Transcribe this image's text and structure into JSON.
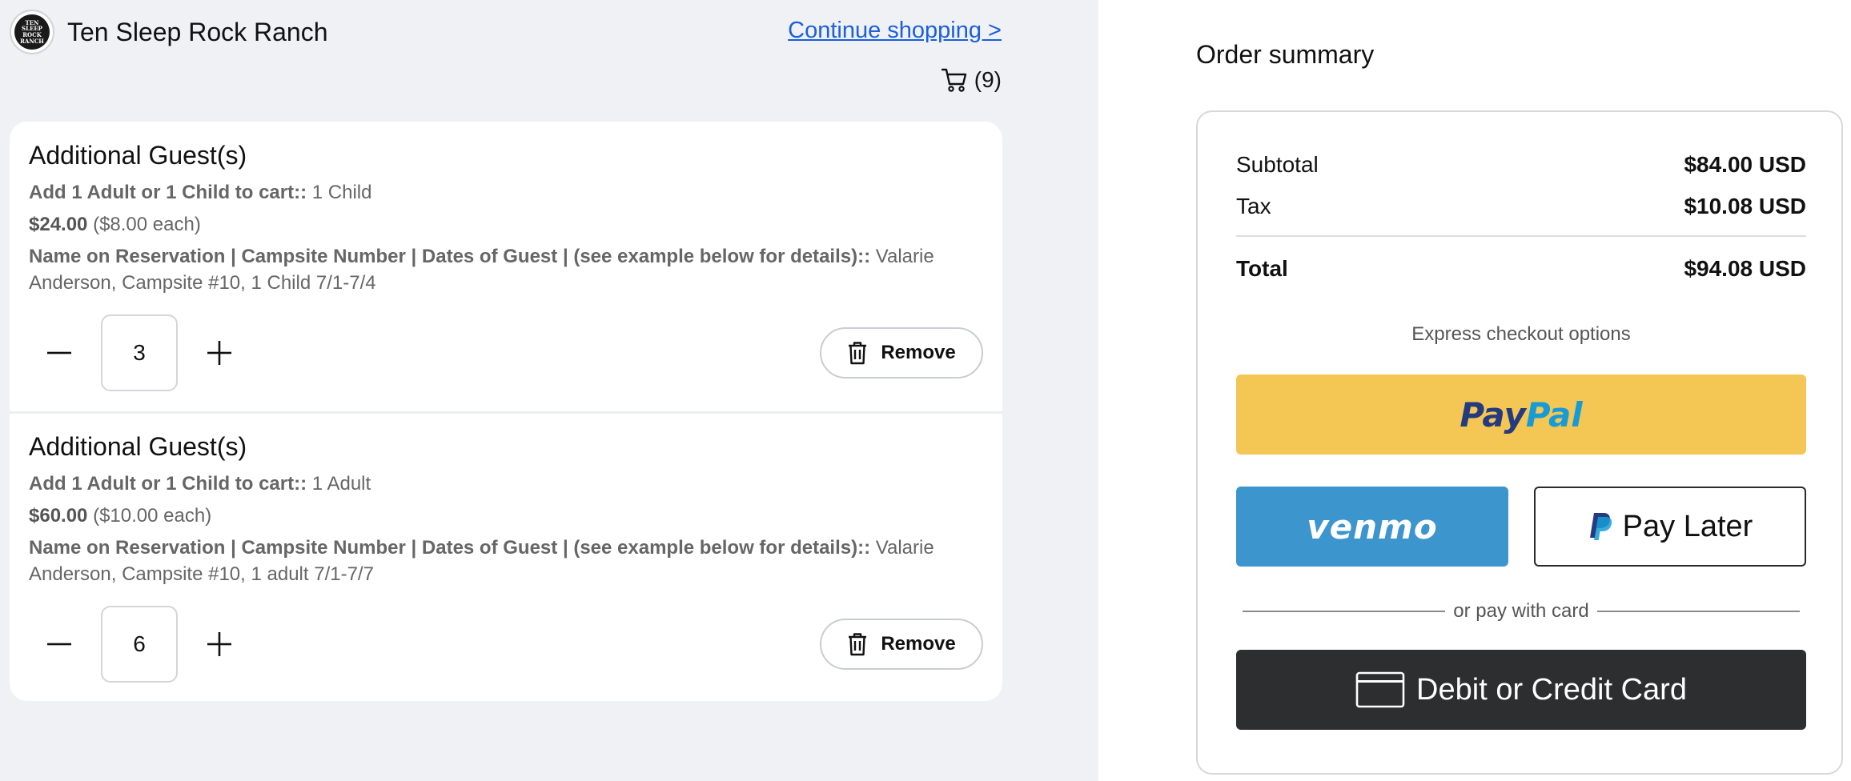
{
  "header": {
    "brand_name": "Ten Sleep Rock Ranch",
    "logo_text": "TEN SLEEP ROCK RANCH",
    "continue_label": "Continue shopping >",
    "cart_count": "(9)"
  },
  "cart_items": [
    {
      "title": "Additional Guest(s)",
      "option_label": "Add 1 Adult or 1 Child to cart::",
      "option_value": "1 Child",
      "price": "$24.00",
      "unit_price": "($8.00 each)",
      "note_label": "Name on Reservation | Campsite Number | Dates of Guest | (see example below for details)::",
      "note_value": "Valarie Anderson, Campsite #10, 1 Child 7/1-7/4",
      "quantity": "3",
      "remove_label": "Remove"
    },
    {
      "title": "Additional Guest(s)",
      "option_label": "Add 1 Adult or 1 Child to cart::",
      "option_value": "1 Adult",
      "price": "$60.00",
      "unit_price": "($10.00 each)",
      "note_label": "Name on Reservation | Campsite Number | Dates of Guest | (see example below for details)::",
      "note_value": "Valarie Anderson, Campsite #10, 1 adult 7/1-7/7",
      "quantity": "6",
      "remove_label": "Remove"
    }
  ],
  "summary": {
    "title": "Order summary",
    "subtotal_label": "Subtotal",
    "subtotal_value": "$84.00 USD",
    "tax_label": "Tax",
    "tax_value": "$10.08 USD",
    "total_label": "Total",
    "total_value": "$94.08 USD",
    "express_label": "Express checkout options",
    "paypal_part1": "Pay",
    "paypal_part2": "Pal",
    "venmo_label": "venmo",
    "paylater_label": "Pay Later",
    "or_label": "or pay with card",
    "card_label": "Debit or Credit Card"
  },
  "colors": {
    "left_background": "#eff1f5",
    "link": "#1a5fdc",
    "paypal_yellow": "#f4c653",
    "venmo_blue": "#3d95ce",
    "card_dark": "#2c2e2f"
  }
}
